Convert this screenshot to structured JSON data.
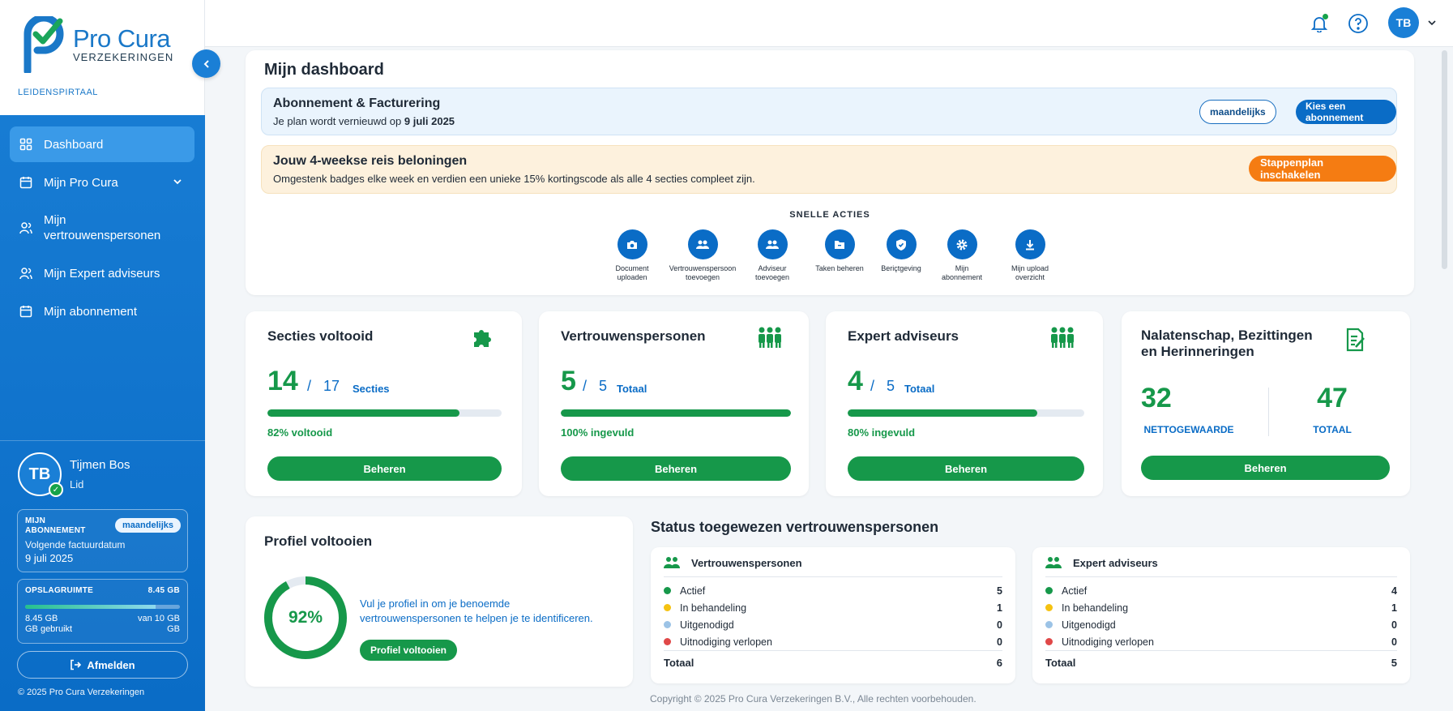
{
  "brand": {
    "name": "Pro Cura",
    "subtitle": "VERZEKERINGEN",
    "portal": "LEIDENSPIRTAAL",
    "colors": {
      "primary": "#0a6cc6",
      "green": "#16984a",
      "orange": "#f57c12"
    }
  },
  "sidebar": {
    "items": [
      {
        "label": "Dashboard",
        "icon": "grid-icon",
        "active": true
      },
      {
        "label": "Mijn Pro Cura",
        "icon": "calendar-icon"
      },
      {
        "label": "Mijn vertrouwenspersonen",
        "icon": "users-icon"
      },
      {
        "label": "Mijn Expert adviseurs",
        "icon": "users-icon"
      },
      {
        "label": "Mijn abonnement",
        "icon": "calendar-icon"
      }
    ],
    "user": {
      "initials": "TB",
      "name": "Tijmen Bos",
      "role": "Lid"
    },
    "subscription": {
      "label_line1": "MIJN",
      "label_line2": "ABONNEMENT",
      "badge": "maandelijks",
      "next_label": "Volgende factuurdatum",
      "next_date": "9 juli 2025"
    },
    "storage": {
      "label": "OPSLAGRUIMTE",
      "used_total": "8.45 GB",
      "used_line1": "8.45 GB",
      "used_line2": "GB gebruikt",
      "cap_line1": "van 10 GB",
      "cap_line2": "GB",
      "fraction": 0.845
    },
    "logout": "Afmelden",
    "copyright": "© 2025 Pro Cura Verzekeringen"
  },
  "topbar": {
    "initials": "TB"
  },
  "main": {
    "title": "Mijn dashboard",
    "billing": {
      "title": "Abonnement & Facturering",
      "sub_prefix": "Je plan wordt vernieuwd op",
      "sub_date": "9 juli 2025",
      "btn_period": "maandelijks",
      "btn_choose": "Kies een abonnement"
    },
    "rewards": {
      "title": "Jouw 4-weekse reis beloningen",
      "sub": "Omgestenk badges elke week en verdien een unieke 15% kortingscode als alle 4 secties compleet zijn.",
      "button": "Stappenplan inschakelen"
    },
    "quick_title": "SNELLE ACTIES",
    "quick_actions": [
      {
        "line1": "Document",
        "line2": "uploaden",
        "icon": "camera-icon"
      },
      {
        "line1": "Vertrouwenspersoon",
        "line2": "toevoegen",
        "icon": "users-add-icon"
      },
      {
        "line1": "Adviseur",
        "line2": "toevoegen",
        "icon": "users-add-icon"
      },
      {
        "line1": "Taken beheren",
        "line2": "",
        "icon": "folder-icon"
      },
      {
        "line1": "Beriçtgeving",
        "line2": "",
        "icon": "shield-icon"
      },
      {
        "line1": "Mijn",
        "line2": "abonnement",
        "icon": "gear-icon"
      },
      {
        "line1": "Mijn upload",
        "line2": "overzicht",
        "icon": "download-icon"
      }
    ],
    "stats": [
      {
        "title": "Secties voltooid",
        "value": "14",
        "of": "17",
        "unit": "Secties",
        "fraction": 0.82,
        "pct": "82% voltooid",
        "button": "Beheren",
        "icon": "puzzle-icon"
      },
      {
        "title": "Vertrouwenspersonen",
        "value": "5",
        "of": "5",
        "unit": "Totaal",
        "fraction": 1.0,
        "pct": "100% ingevuld",
        "button": "Beheren",
        "icon": "people-icon"
      },
      {
        "title": "Expert adviseurs",
        "value": "4",
        "of": "5",
        "unit": "Totaal",
        "fraction": 0.8,
        "pct": "80% ingevuld",
        "button": "Beheren",
        "icon": "people-icon"
      }
    ],
    "nalatenschap": {
      "title": "Nalatenschap, Bezittingen en Herinneringen",
      "left_value": "32",
      "left_label": "NETTOGEWAARDE",
      "right_value": "47",
      "right_label": "TOTAAL",
      "button": "Beheren"
    },
    "profile": {
      "title": "Profiel voltooien",
      "percent": "92%",
      "fraction": 0.92,
      "description": "Vul je profiel in om je benoemde vertrouwenspersonen te helpen je te identificeren.",
      "button": "Profiel voltooien"
    },
    "status": {
      "title": "Status toegewezen vertrouwenspersonen",
      "cards": [
        {
          "title": "Vertrouwenspersonen",
          "rows": [
            {
              "label": "Actief",
              "value": "5",
              "color": "#16984a"
            },
            {
              "label": "In behandeling",
              "value": "1",
              "color": "#f5c211"
            },
            {
              "label": "Uitgenodigd",
              "value": "0",
              "color": "#9cc3e6"
            },
            {
              "label": "Uitnodiging verlopen",
              "value": "0",
              "color": "#e04848"
            }
          ],
          "total_label": "Totaal",
          "total_value": "6"
        },
        {
          "title": "Expert adviseurs",
          "rows": [
            {
              "label": "Actief",
              "value": "4",
              "color": "#16984a"
            },
            {
              "label": "In behandeling",
              "value": "1",
              "color": "#f5c211"
            },
            {
              "label": "Uitgenodigd",
              "value": "0",
              "color": "#9cc3e6"
            },
            {
              "label": "Uitnodiging verlopen",
              "value": "0",
              "color": "#e04848"
            }
          ],
          "total_label": "Totaal",
          "total_value": "5"
        }
      ]
    },
    "footer": "Copyright © 2025 Pro Cura Verzekeringen B.V., Alle rechten voorbehouden."
  }
}
